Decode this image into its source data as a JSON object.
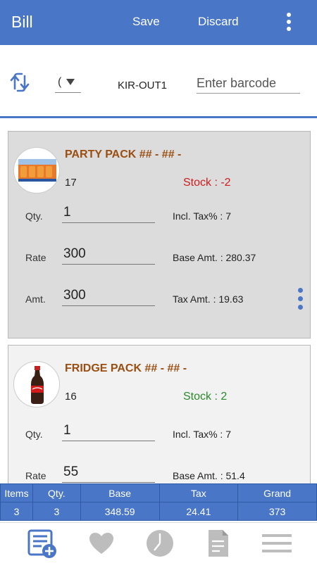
{
  "appbar": {
    "title": "Bill",
    "save_label": "Save",
    "discard_label": "Discard",
    "more_icon": "more-vert-icon"
  },
  "toolbar": {
    "sync_icon": "sync-icon",
    "dropdown_value": "(",
    "location": "KIR-OUT1",
    "barcode_placeholder": "Enter barcode"
  },
  "items": [
    {
      "name": "PARTY PACK ## - ## -",
      "code": "17",
      "stock": "Stock : -2",
      "qty_label": "Qty.",
      "qty": "1",
      "rate_label": "Rate",
      "rate": "300",
      "amt_label": "Amt.",
      "amt": "300",
      "incl_tax": "Incl. Tax% : 7",
      "base_amt": "Base Amt. : 280.37",
      "tax_amt": "Tax Amt. : 19.63",
      "stock_color": "#d01c1c"
    },
    {
      "name": "FRIDGE PACK ## - ## -",
      "code": "16",
      "stock": "Stock : 2",
      "qty_label": "Qty.",
      "qty": "1",
      "rate_label": "Rate",
      "rate": "55",
      "incl_tax": "Incl. Tax% : 7",
      "base_amt": "Base Amt. : 51.4",
      "stock_color": "#2a8a2a"
    }
  ],
  "summary": {
    "headers": [
      "Items",
      "Qty.",
      "Base",
      "Tax",
      "Grand"
    ],
    "values": [
      "3",
      "3",
      "348.59",
      "24.41",
      "373"
    ]
  },
  "nav": {
    "items": [
      "add-bill-icon",
      "heart-icon",
      "clock-icon",
      "document-icon",
      "menu-icon"
    ]
  },
  "colors": {
    "accent": "#4a76c8",
    "product_name": "#9a4e11"
  }
}
